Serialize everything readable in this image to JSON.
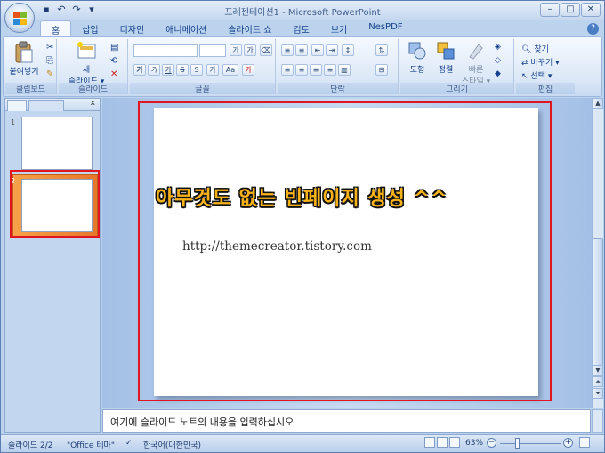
{
  "window": {
    "title": "프레젠테이션1 - Microsoft PowerPoint",
    "controls": {
      "minimize": "–",
      "maximize": "□",
      "close": "✕"
    }
  },
  "tabs": [
    {
      "label": "홈",
      "active": true
    },
    {
      "label": "삽입"
    },
    {
      "label": "디자인"
    },
    {
      "label": "애니메이션"
    },
    {
      "label": "슬라이드 쇼"
    },
    {
      "label": "검토"
    },
    {
      "label": "보기"
    },
    {
      "label": "NesPDF"
    }
  ],
  "ribbon": {
    "clipboard": {
      "group": "클립보드",
      "paste": "붙여넣기"
    },
    "slides": {
      "group": "슬라이드",
      "new_slide_line1": "새",
      "new_slide_line2": "슬라이드 ▾"
    },
    "font": {
      "group": "글꼴",
      "size_up": "가",
      "size_down": "가",
      "bold": "가",
      "italic": "가",
      "underline": "가",
      "strike": "S",
      "spacing": "가",
      "case": "Aa",
      "color": "가"
    },
    "paragraph": {
      "group": "단락"
    },
    "drawing": {
      "group": "그리기",
      "shapes": "도형",
      "arrange": "정렬",
      "quick_styles": "빠른",
      "quick_styles2": "스타일 ▾"
    },
    "editing": {
      "group": "편집",
      "find": "찾기",
      "replace": "바꾸기 ▾",
      "select": "선택 ▾"
    }
  },
  "slides_pane": {
    "slide_numbers": [
      "1",
      "2"
    ],
    "close": "x"
  },
  "slide": {
    "headline": "아무것도 없는 빈페이지 생성 ^^",
    "url": "http://themecreator.tistory.com"
  },
  "notes": {
    "placeholder": "여기에 슬라이드 노트의 내용을 입력하십시오"
  },
  "status": {
    "slide_pos": "슬라이드 2/2",
    "theme": "\"Office 테마\"",
    "language": "한국어(대한민국)",
    "zoom": "63%"
  },
  "colors": {
    "highlight": "#e0151f",
    "headline": "#f7b21a",
    "selected_thumb": "#e6772a"
  }
}
